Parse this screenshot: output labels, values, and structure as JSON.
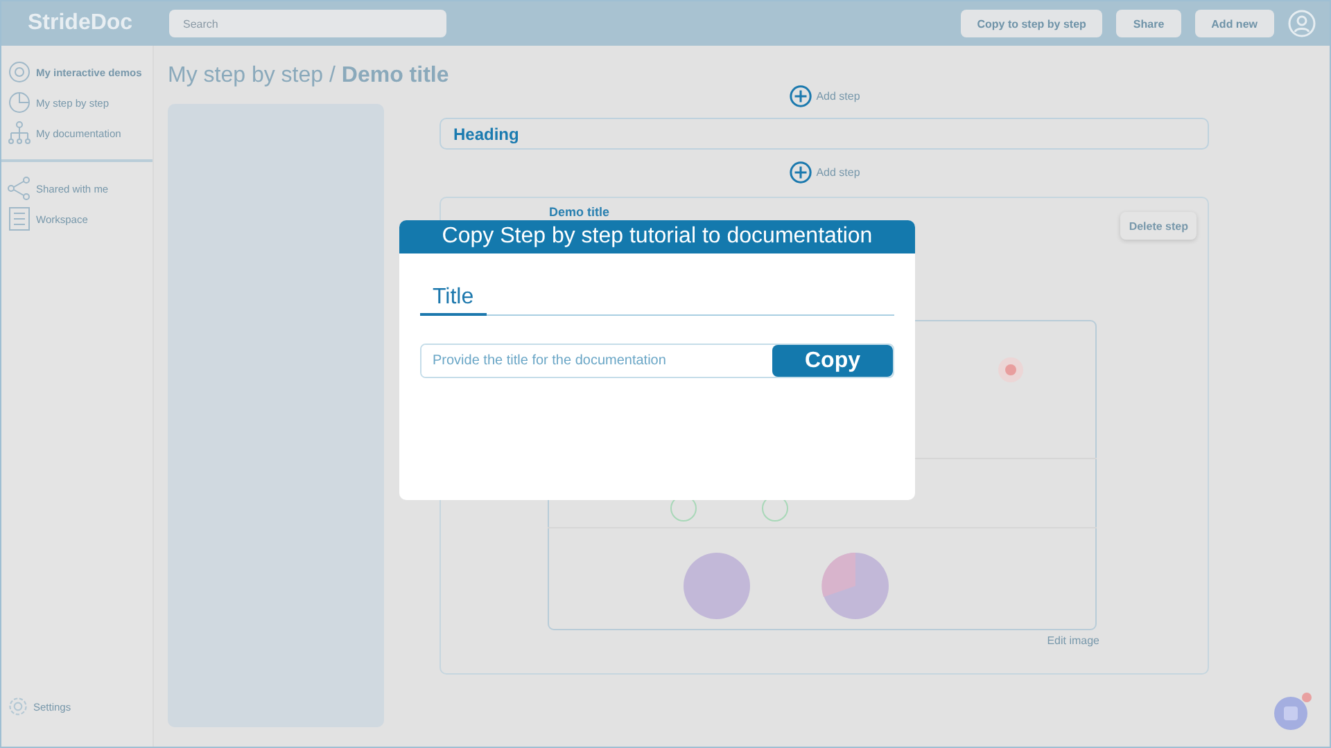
{
  "app": {
    "name": "StrideDoc"
  },
  "search": {
    "placeholder": "Search"
  },
  "header_buttons": [
    "Copy to step by step",
    "Share",
    "Add new"
  ],
  "sidebar": {
    "groups": [
      [
        {
          "label": "My interactive demos",
          "selected": true
        },
        {
          "label": "My step by step",
          "selected": false
        },
        {
          "label": "My documentation",
          "selected": false
        }
      ],
      [
        {
          "label": "Shared with me",
          "selected": false
        },
        {
          "label": "Workspace",
          "selected": false
        }
      ]
    ],
    "settings": "Settings"
  },
  "breadcrumb": {
    "parent": "My step by step / ",
    "current": "Demo title"
  },
  "steps": [
    {
      "kind": "add",
      "label": "Add step"
    },
    {
      "kind": "heading",
      "text": "Heading"
    },
    {
      "kind": "add",
      "label": "Add step"
    },
    {
      "kind": "card",
      "title": "Demo title",
      "delete": "Delete step",
      "edit": "Edit image"
    }
  ],
  "modal": {
    "title": "Copy Step by step tutorial to documentation",
    "tabs": [
      {
        "label": "Title",
        "selected": true
      }
    ],
    "input": {
      "placeholder": "Provide the title for the documentation"
    },
    "button": "Copy"
  }
}
